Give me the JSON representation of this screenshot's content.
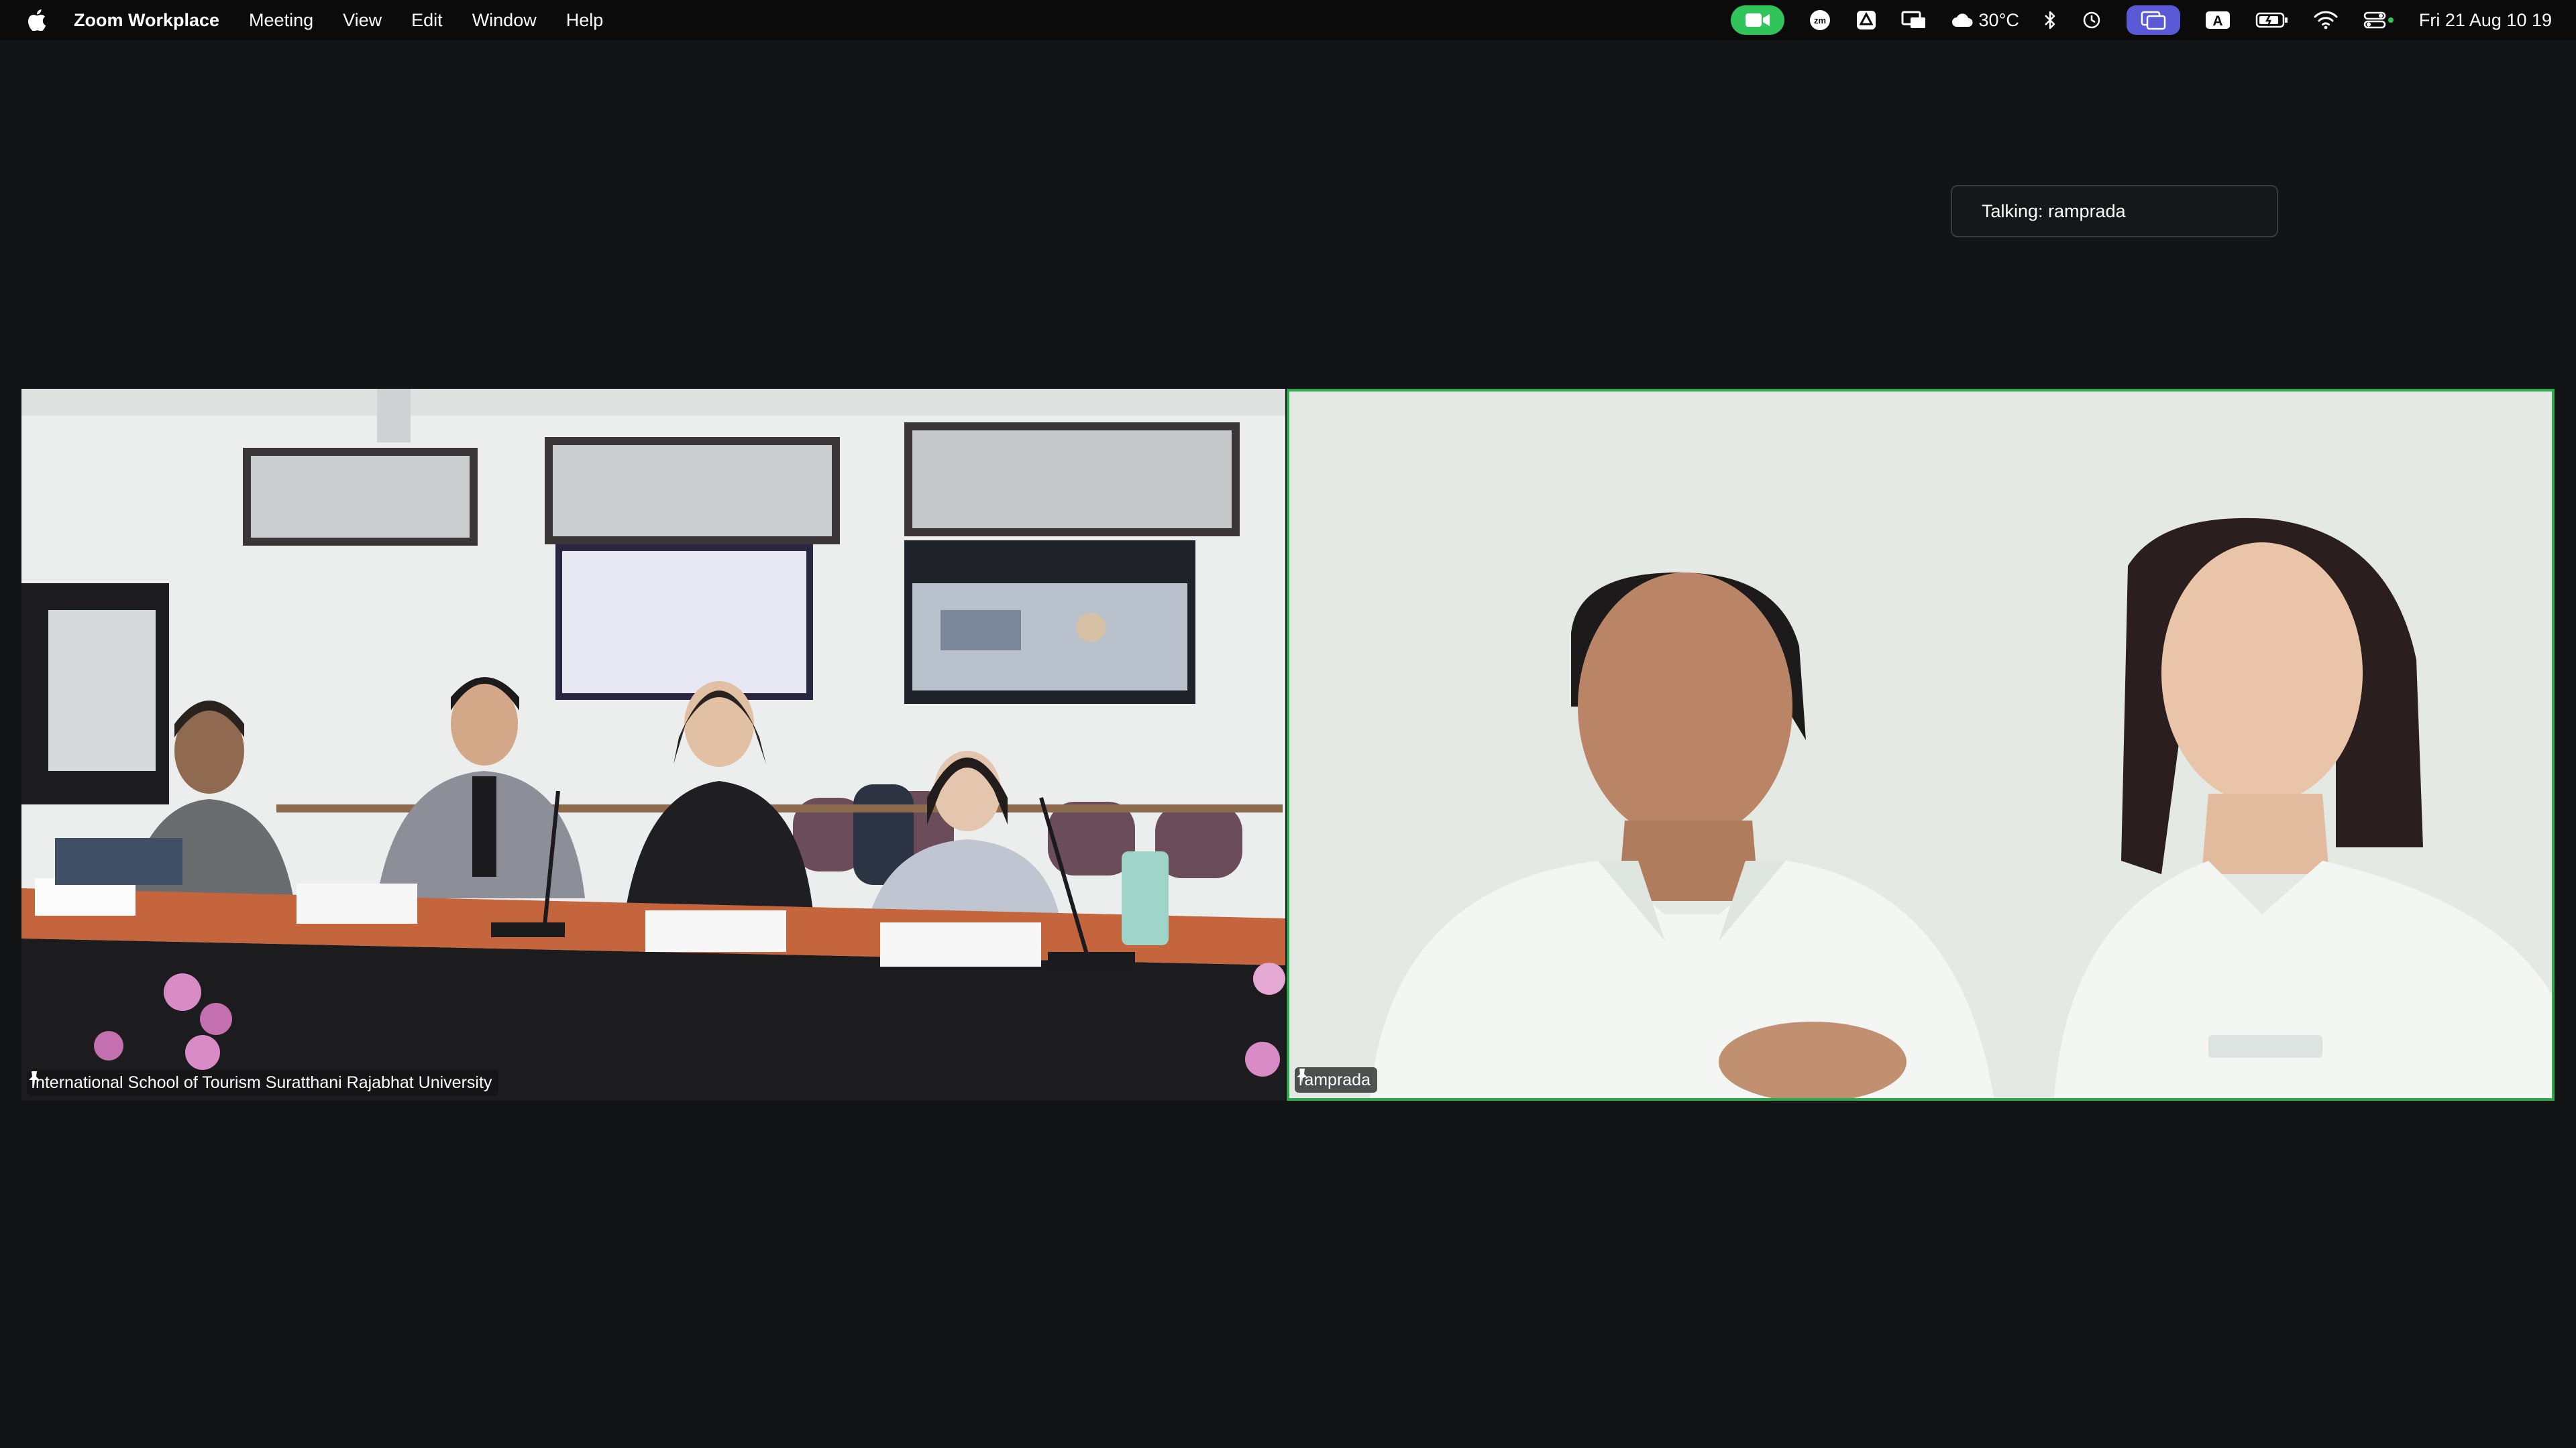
{
  "menubar": {
    "app_name": "Zoom Workplace",
    "menus": [
      "Meeting",
      "View",
      "Edit",
      "Window",
      "Help"
    ],
    "status": {
      "weather": "30°C",
      "datetime": "Fri 21 Aug  10 19",
      "keyboard_input": "A"
    }
  },
  "meeting": {
    "talking_indicator": "Talking: ramprada",
    "active_speaker_color": "#2fa84f",
    "participants": [
      {
        "name": "International School of Tourism Suratthani Rajabhat University",
        "pinned": true,
        "active_speaker": false
      },
      {
        "name": "ramprada",
        "pinned": true,
        "active_speaker": true
      }
    ]
  }
}
